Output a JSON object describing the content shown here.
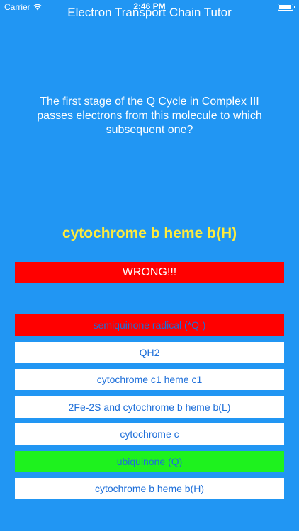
{
  "status_bar": {
    "carrier": "Carrier",
    "time": "2:46 PM"
  },
  "app_title": "Electron Transport Chain Tutor",
  "question": "The first stage of the Q Cycle in Complex III passes electrons from this molecule to which subsequent one?",
  "current_molecule": "cytochrome b heme b(H)",
  "result": "WRONG!!!",
  "answers": [
    {
      "label": "semiquinone radical (*Q-)",
      "state": "wrong"
    },
    {
      "label": "QH2",
      "state": "normal"
    },
    {
      "label": "cytochrome c1 heme c1",
      "state": "normal"
    },
    {
      "label": "2Fe-2S and cytochrome b heme b(L)",
      "state": "normal"
    },
    {
      "label": "cytochrome c",
      "state": "normal"
    },
    {
      "label": "ubiquinone (Q)",
      "state": "correct"
    },
    {
      "label": "cytochrome b heme b(H)",
      "state": "normal"
    }
  ],
  "colors": {
    "background": "#2196f3",
    "molecule_text": "#ffeb3b",
    "wrong": "#ff0000",
    "correct": "#1ef21e",
    "answer_text": "#1e6fd9"
  }
}
